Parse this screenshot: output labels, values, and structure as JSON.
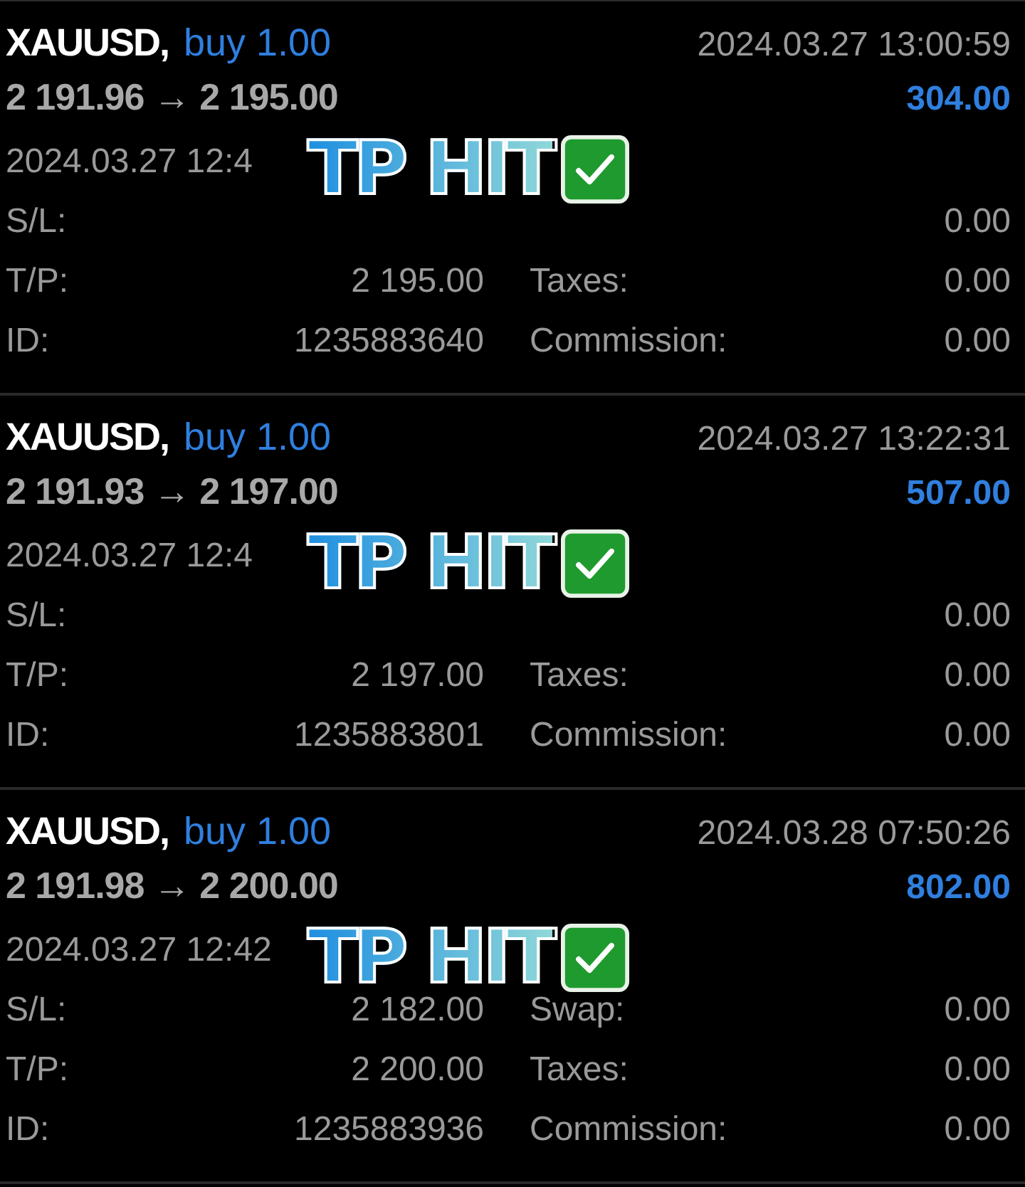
{
  "trades": [
    {
      "symbol": "XAUUSD,",
      "side": "buy 1.00",
      "close_time": "2024.03.27 13:00:59",
      "prices": "2 191.96 → 2 195.00",
      "profit": "304.00",
      "open_time": "2024.03.27 12:4",
      "stamp": "TP HIT",
      "fields": [
        {
          "label": "S/L:"
        },
        {
          "value": "0.00"
        },
        {
          "label": "T/P:",
          "value": "2 195.00"
        },
        {
          "label": "Taxes:",
          "value": "0.00"
        },
        {
          "label": "ID:",
          "value": "1235883640"
        },
        {
          "label": "Commission:",
          "value": "0.00"
        }
      ]
    },
    {
      "symbol": "XAUUSD,",
      "side": "buy 1.00",
      "close_time": "2024.03.27 13:22:31",
      "prices": "2 191.93 → 2 197.00",
      "profit": "507.00",
      "open_time": "2024.03.27 12:4",
      "stamp": "TP HIT",
      "fields": [
        {
          "label": "S/L:"
        },
        {
          "value": "0.00"
        },
        {
          "label": "T/P:",
          "value": "2 197.00"
        },
        {
          "label": "Taxes:",
          "value": "0.00"
        },
        {
          "label": "ID:",
          "value": "1235883801"
        },
        {
          "label": "Commission:",
          "value": "0.00"
        }
      ]
    },
    {
      "symbol": "XAUUSD,",
      "side": "buy 1.00",
      "close_time": "2024.03.28 07:50:26",
      "prices": "2 191.98 → 2 200.00",
      "profit": "802.00",
      "open_time": "2024.03.27 12:42",
      "stamp": "TP HIT",
      "fields": [
        {
          "label": "S/L:",
          "value": "2 182.00"
        },
        {
          "label": "Swap:",
          "value": "0.00"
        },
        {
          "label": "T/P:",
          "value": "2 200.00"
        },
        {
          "label": "Taxes:",
          "value": "0.00"
        },
        {
          "label": "ID:",
          "value": "1235883936"
        },
        {
          "label": "Commission:",
          "value": "0.00"
        }
      ]
    }
  ]
}
